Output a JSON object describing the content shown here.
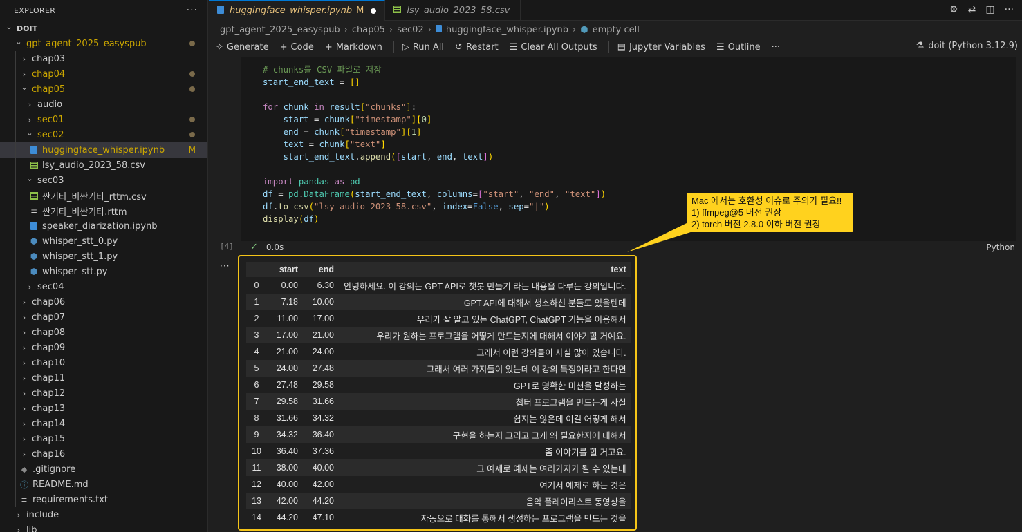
{
  "explorer": {
    "title": "EXPLORER",
    "more": "···",
    "tree": [
      {
        "label": "DOIT",
        "depth": 0,
        "type": "root",
        "open": true
      },
      {
        "label": "gpt_agent_2025_easyspub",
        "depth": 1,
        "type": "folder",
        "open": true,
        "modified": true
      },
      {
        "label": "chap03",
        "depth": 2,
        "type": "folder",
        "open": false
      },
      {
        "label": "chap04",
        "depth": 2,
        "type": "folder",
        "open": false,
        "modified": true
      },
      {
        "label": "chap05",
        "depth": 2,
        "type": "folder",
        "open": true,
        "modified": true
      },
      {
        "label": "audio",
        "depth": 3,
        "type": "folder",
        "open": false
      },
      {
        "label": "sec01",
        "depth": 3,
        "type": "folder",
        "open": false,
        "modified": true
      },
      {
        "label": "sec02",
        "depth": 3,
        "type": "folder",
        "open": true,
        "modified": true
      },
      {
        "label": "huggingface_whisper.ipynb",
        "depth": 4,
        "type": "notebook",
        "modified": true,
        "badge": "M",
        "selected": true
      },
      {
        "label": "lsy_audio_2023_58.csv",
        "depth": 4,
        "type": "csv"
      },
      {
        "label": "sec03",
        "depth": 3,
        "type": "folder",
        "open": true
      },
      {
        "label": "싼기타_비싼기타_rttm.csv",
        "depth": 4,
        "type": "csv"
      },
      {
        "label": "싼기타_비싼기타.rttm",
        "depth": 4,
        "type": "rttm"
      },
      {
        "label": "speaker_diarization.ipynb",
        "depth": 4,
        "type": "notebook"
      },
      {
        "label": "whisper_stt_0.py",
        "depth": 4,
        "type": "python"
      },
      {
        "label": "whisper_stt_1.py",
        "depth": 4,
        "type": "python"
      },
      {
        "label": "whisper_stt.py",
        "depth": 4,
        "type": "python"
      },
      {
        "label": "sec04",
        "depth": 3,
        "type": "folder",
        "open": false
      },
      {
        "label": "chap06",
        "depth": 2,
        "type": "folder",
        "open": false
      },
      {
        "label": "chap07",
        "depth": 2,
        "type": "folder",
        "open": false
      },
      {
        "label": "chap08",
        "depth": 2,
        "type": "folder",
        "open": false
      },
      {
        "label": "chap09",
        "depth": 2,
        "type": "folder",
        "open": false
      },
      {
        "label": "chap10",
        "depth": 2,
        "type": "folder",
        "open": false
      },
      {
        "label": "chap11",
        "depth": 2,
        "type": "folder",
        "open": false
      },
      {
        "label": "chap12",
        "depth": 2,
        "type": "folder",
        "open": false
      },
      {
        "label": "chap13",
        "depth": 2,
        "type": "folder",
        "open": false
      },
      {
        "label": "chap14",
        "depth": 2,
        "type": "folder",
        "open": false
      },
      {
        "label": "chap15",
        "depth": 2,
        "type": "folder",
        "open": false
      },
      {
        "label": "chap16",
        "depth": 2,
        "type": "folder",
        "open": false
      },
      {
        "label": ".gitignore",
        "depth": 2,
        "type": "gitignore"
      },
      {
        "label": "README.md",
        "depth": 2,
        "type": "info"
      },
      {
        "label": "requirements.txt",
        "depth": 2,
        "type": "text"
      },
      {
        "label": "include",
        "depth": 1,
        "type": "folder",
        "open": false
      },
      {
        "label": "lib",
        "depth": 1,
        "type": "folder",
        "open": false
      }
    ]
  },
  "tabs": [
    {
      "label": "huggingface_whisper.ipynb",
      "flag": "M",
      "active": true,
      "icon": "notebook-icon"
    },
    {
      "label": "lsy_audio_2023_58.csv",
      "active": false,
      "icon": "csv-icon"
    }
  ],
  "breadcrumb": [
    "gpt_agent_2025_easyspub",
    "chap05",
    "sec02",
    "huggingface_whisper.ipynb",
    "empty cell"
  ],
  "toolbar": {
    "generate": "Generate",
    "code": "Code",
    "markdown": "Markdown",
    "run_all": "Run All",
    "restart": "Restart",
    "clear_outputs": "Clear All Outputs",
    "variables": "Jupyter Variables",
    "outline": "Outline",
    "more": "···",
    "kernel": "doit (Python 3.12.9)"
  },
  "cell": {
    "exec_count": "[4]",
    "duration": "0.0s",
    "language": "Python",
    "output_more": "···"
  },
  "callout": {
    "line1": "Mac 에서는 호환성 이슈로 주의가 필요!!",
    "line2": "1) ffmpeg@5  버전 권장",
    "line3": "2) torch 버전 2.8.0 이하 버전 권장"
  },
  "table": {
    "columns": [
      "",
      "start",
      "end",
      "text"
    ],
    "rows": [
      [
        "0",
        "0.00",
        "6.30",
        "안녕하세요. 이 강의는 GPT API로 챗봇 만들기 라는 내용을 다루는 강의입니다."
      ],
      [
        "1",
        "7.18",
        "10.00",
        "GPT API에 대해서 생소하신 분들도 있을텐데"
      ],
      [
        "2",
        "11.00",
        "17.00",
        "우리가 잘 알고 있는 ChatGPT, ChatGPT 기능을 이용해서"
      ],
      [
        "3",
        "17.00",
        "21.00",
        "우리가 원하는 프로그램을 어떻게 만드는지에 대해서 이야기할 거예요."
      ],
      [
        "4",
        "21.00",
        "24.00",
        "그래서 이런 강의들이 사실 많이 있습니다."
      ],
      [
        "5",
        "24.00",
        "27.48",
        "그래서 여러 가지들이 있는데 이 강의 특징이라고 한다면"
      ],
      [
        "6",
        "27.48",
        "29.58",
        "GPT로 명확한 미션을 달성하는"
      ],
      [
        "7",
        "29.58",
        "31.66",
        "첩터 프로그램을 만드는게 사실"
      ],
      [
        "8",
        "31.66",
        "34.32",
        "쉽지는 않은데 이걸 어떻게 해서"
      ],
      [
        "9",
        "34.32",
        "36.40",
        "구현을 하는지 그리고 그게 왜 필요한지에 대해서"
      ],
      [
        "10",
        "36.40",
        "37.36",
        "좀 이야기를 할 거고요."
      ],
      [
        "11",
        "38.00",
        "40.00",
        "그 예제로 예제는 여러가지가 될 수 있는데"
      ],
      [
        "12",
        "40.00",
        "42.00",
        "여기서 예제로 하는 것은"
      ],
      [
        "13",
        "42.00",
        "44.20",
        "음악 플레이리스트 동영상을"
      ],
      [
        "14",
        "44.20",
        "47.10",
        "자동으로 대화를 통해서 생성하는 프로그램을 만드는 것을"
      ]
    ]
  },
  "colors": {
    "accent": "#0078d4",
    "modified": "#e6c07b",
    "highlight_border": "#f5c518",
    "callout_bg": "#ffd21e"
  }
}
